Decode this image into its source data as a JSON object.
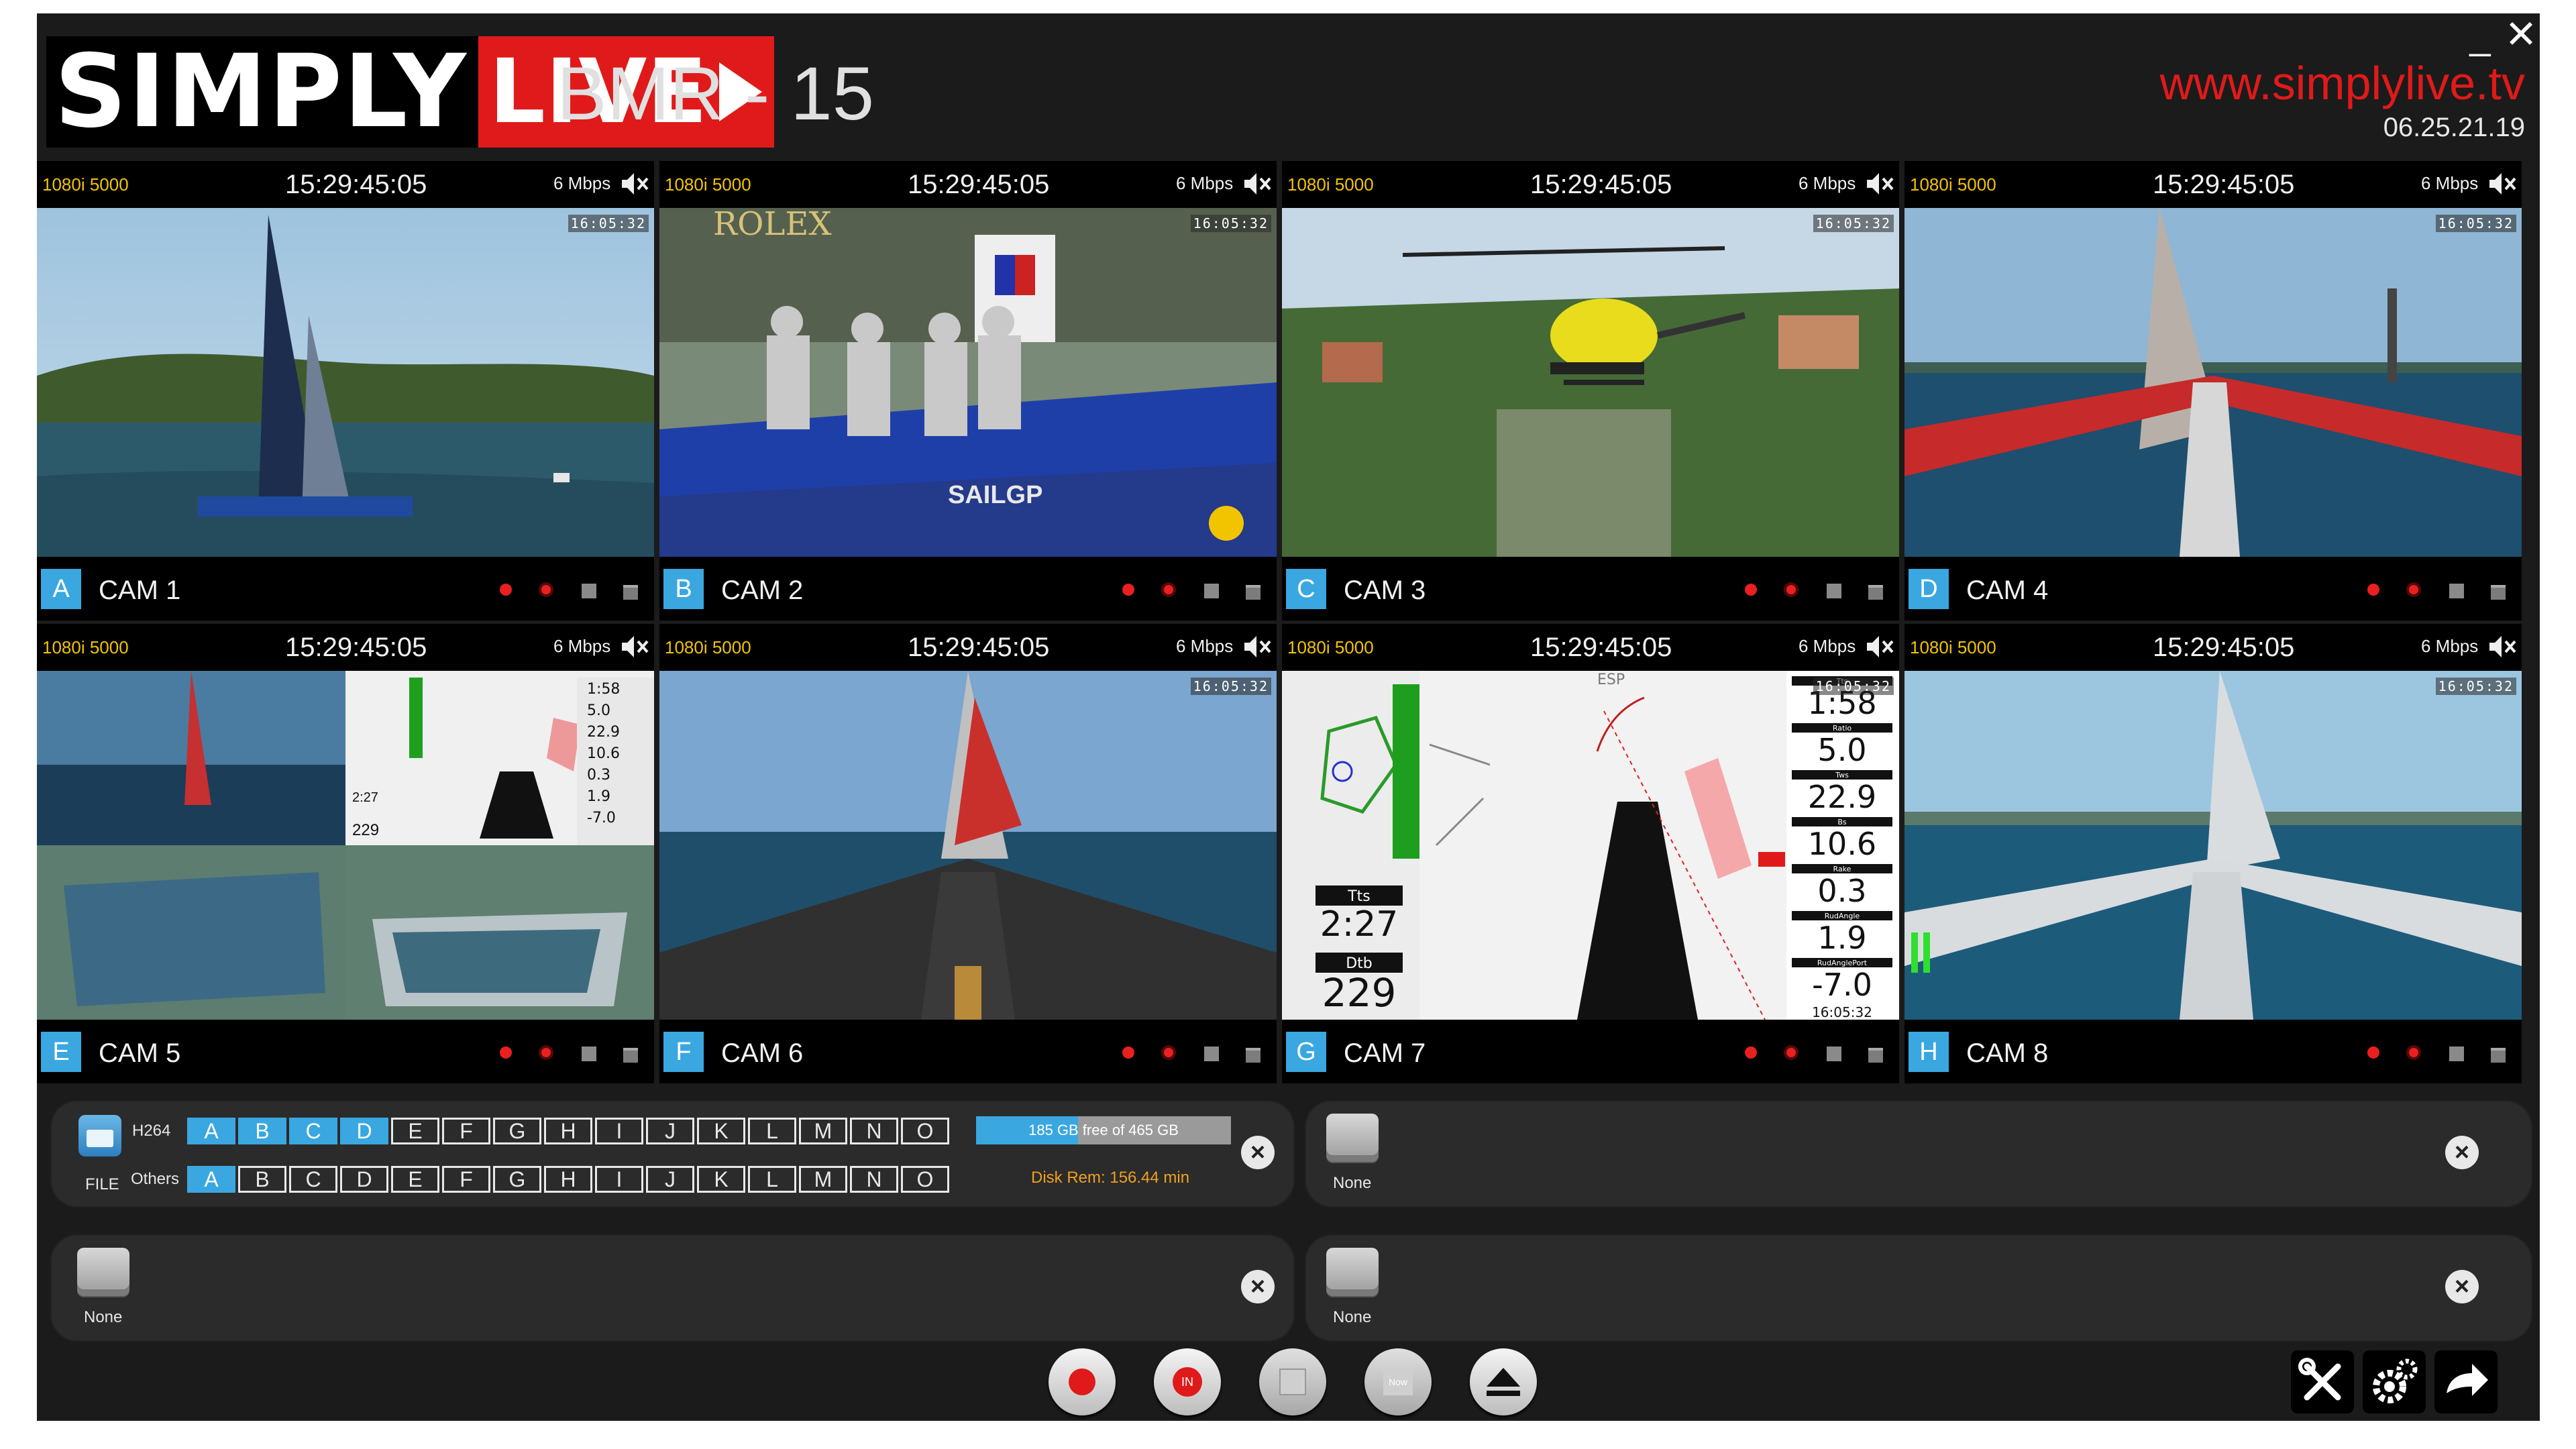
{
  "header": {
    "logo_simply": "SIMPLY",
    "logo_live": "LIVE",
    "app_title": "BMR - 15",
    "site_url": "www.simplylive.tv",
    "build_date": "06.25.21.19",
    "minimize_label": "_",
    "close_label": "✕"
  },
  "cameras": [
    {
      "letter": "A",
      "name": "CAM 1",
      "format": "1080i 5000",
      "time": "15:29:45:05",
      "rate": "6 Mbps",
      "tc": "16:05:32"
    },
    {
      "letter": "B",
      "name": "CAM 2",
      "format": "1080i 5000",
      "time": "15:29:45:05",
      "rate": "6 Mbps",
      "tc": "16:05:32",
      "overlay": "ROLEX",
      "overlay2": "SAILGP"
    },
    {
      "letter": "C",
      "name": "CAM 3",
      "format": "1080i 5000",
      "time": "15:29:45:05",
      "rate": "6 Mbps",
      "tc": "16:05:32"
    },
    {
      "letter": "D",
      "name": "CAM 4",
      "format": "1080i 5000",
      "time": "15:29:45:05",
      "rate": "6 Mbps",
      "tc": "16:05:32"
    },
    {
      "letter": "E",
      "name": "CAM 5",
      "format": "1080i 5000",
      "time": "15:29:45:05",
      "rate": "6 Mbps",
      "mini": [
        "1:58",
        "5.0",
        "22.9",
        "10.6",
        "0.3",
        "1.9",
        "-7.0"
      ],
      "mini_tts": "2:27",
      "mini_dtb": "229"
    },
    {
      "letter": "F",
      "name": "CAM 6",
      "format": "1080i 5000",
      "time": "15:29:45:05",
      "rate": "6 Mbps",
      "tc": "16:05:32"
    },
    {
      "letter": "G",
      "name": "CAM 7",
      "format": "1080i 5000",
      "time": "15:29:45:05",
      "rate": "6 Mbps",
      "tc": "16:05:32",
      "esp": "ESP",
      "tts_label": "Tts",
      "tts": "2:27",
      "dtb_label": "Dtb",
      "dtb": "229",
      "stats": [
        {
          "label": "Tts",
          "value": "1:58"
        },
        {
          "label": "Ratio",
          "value": "5.0"
        },
        {
          "label": "Tws",
          "value": "22.9"
        },
        {
          "label": "Bs",
          "value": "10.6"
        },
        {
          "label": "Rake",
          "value": "0.3"
        },
        {
          "label": "RudAngle",
          "value": "1.9"
        },
        {
          "label": "RudAnglePort",
          "value": "-7.0"
        }
      ],
      "stats_time": "16:05:32"
    },
    {
      "letter": "H",
      "name": "CAM 8",
      "format": "1080i 5000",
      "time": "15:29:45:05",
      "rate": "6 Mbps",
      "tc": "16:05:32"
    }
  ],
  "recorder": {
    "file_label": "FILE",
    "h264_label": "H264",
    "others_label": "Others",
    "letters": [
      "A",
      "B",
      "C",
      "D",
      "E",
      "F",
      "G",
      "H",
      "I",
      "J",
      "K",
      "L",
      "M",
      "N",
      "O"
    ],
    "h264_active": [
      "A",
      "B",
      "C",
      "D"
    ],
    "others_active": [
      "A"
    ],
    "disk_text": "185 GB free of 465 GB",
    "disk_free_fraction": 0.4,
    "disk_rem": "Disk Rem: 156.44 min"
  },
  "slots": {
    "none_label": "None"
  },
  "toolbar": {
    "in_label": "IN",
    "now_label": "Now"
  },
  "colors": {
    "accent": "#3aa7e0",
    "brand_red": "#e01a1a",
    "format_yellow": "#f2c400"
  }
}
